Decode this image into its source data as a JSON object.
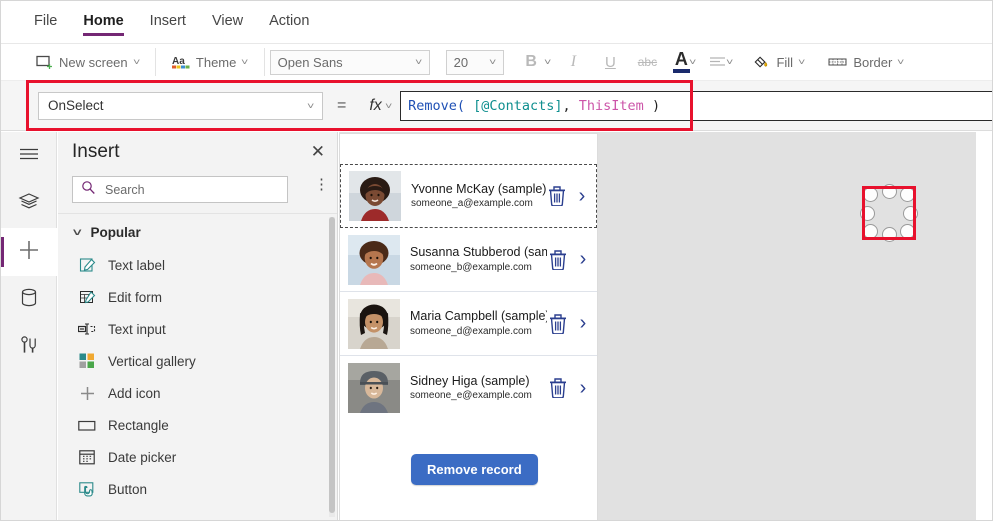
{
  "menubar": {
    "items": [
      {
        "label": "File",
        "active": false
      },
      {
        "label": "Home",
        "active": true
      },
      {
        "label": "Insert",
        "active": false
      },
      {
        "label": "View",
        "active": false
      },
      {
        "label": "Action",
        "active": false
      }
    ]
  },
  "ribbon": {
    "new_screen": "New screen",
    "theme": "Theme",
    "font_family": "Open Sans",
    "font_size": "20",
    "bold": "B",
    "italic": "I",
    "underline": "U",
    "strikethrough": "abc",
    "font_color": "A",
    "align": "align-icon",
    "fill": "Fill",
    "border": "Border"
  },
  "formula_bar": {
    "property": "OnSelect",
    "equals": "=",
    "fx": "fx",
    "formula_full": "Remove( [@Contacts], ThisItem )",
    "formula_tokens": [
      {
        "text": "Remove(",
        "kind": "fx-name"
      },
      {
        "text": " ",
        "kind": "fx-punc"
      },
      {
        "text": "[@Contacts]",
        "kind": "fx-src"
      },
      {
        "text": ", ",
        "kind": "fx-punc"
      },
      {
        "text": "ThisItem",
        "kind": "fx-this"
      },
      {
        "text": " )",
        "kind": "fx-punc"
      }
    ],
    "highlight_color": "#e8112d"
  },
  "rail": {
    "items": [
      {
        "name": "menu-icon",
        "label": "Menu",
        "active": false
      },
      {
        "name": "tree-view-icon",
        "label": "Tree view",
        "active": false
      },
      {
        "name": "insert-icon",
        "label": "Insert",
        "active": true
      },
      {
        "name": "data-icon",
        "label": "Data",
        "active": false
      },
      {
        "name": "advanced-tools-icon",
        "label": "Advanced tools",
        "active": false
      }
    ],
    "active_indicator_color": "#742774"
  },
  "insert_panel": {
    "title": "Insert",
    "close": "✕",
    "search_placeholder": "Search",
    "search_value": "",
    "more_options": "⋮",
    "group_label": "Popular",
    "items": [
      {
        "label": "Text label",
        "icon": "text-label-icon"
      },
      {
        "label": "Edit form",
        "icon": "edit-form-icon"
      },
      {
        "label": "Text input",
        "icon": "text-input-icon"
      },
      {
        "label": "Vertical gallery",
        "icon": "vertical-gallery-icon"
      },
      {
        "label": "Add icon",
        "icon": "add-icon"
      },
      {
        "label": "Rectangle",
        "icon": "rectangle-icon"
      },
      {
        "label": "Date picker",
        "icon": "date-picker-icon"
      },
      {
        "label": "Button",
        "icon": "button-icon"
      }
    ]
  },
  "canvas": {
    "background": "#e1e1e1",
    "screen_background": "#ffffff",
    "gallery": {
      "rows": [
        {
          "name": "Yvonne McKay (sample)",
          "email": "someone_a@example.com",
          "selected": true
        },
        {
          "name": "Susanna Stubberod (sample)",
          "email": "someone_b@example.com",
          "selected": false
        },
        {
          "name": "Maria Campbell (sample)",
          "email": "someone_d@example.com",
          "selected": false
        },
        {
          "name": "Sidney Higa (sample)",
          "email": "someone_e@example.com",
          "selected": false
        }
      ],
      "trash_icon": "trash-icon",
      "chevron_icon": "chevron-right-icon",
      "accent_color": "#2b3f8f"
    },
    "remove_button": {
      "label": "Remove record",
      "background": "#3b6cc4",
      "text_color": "#ffffff"
    }
  }
}
